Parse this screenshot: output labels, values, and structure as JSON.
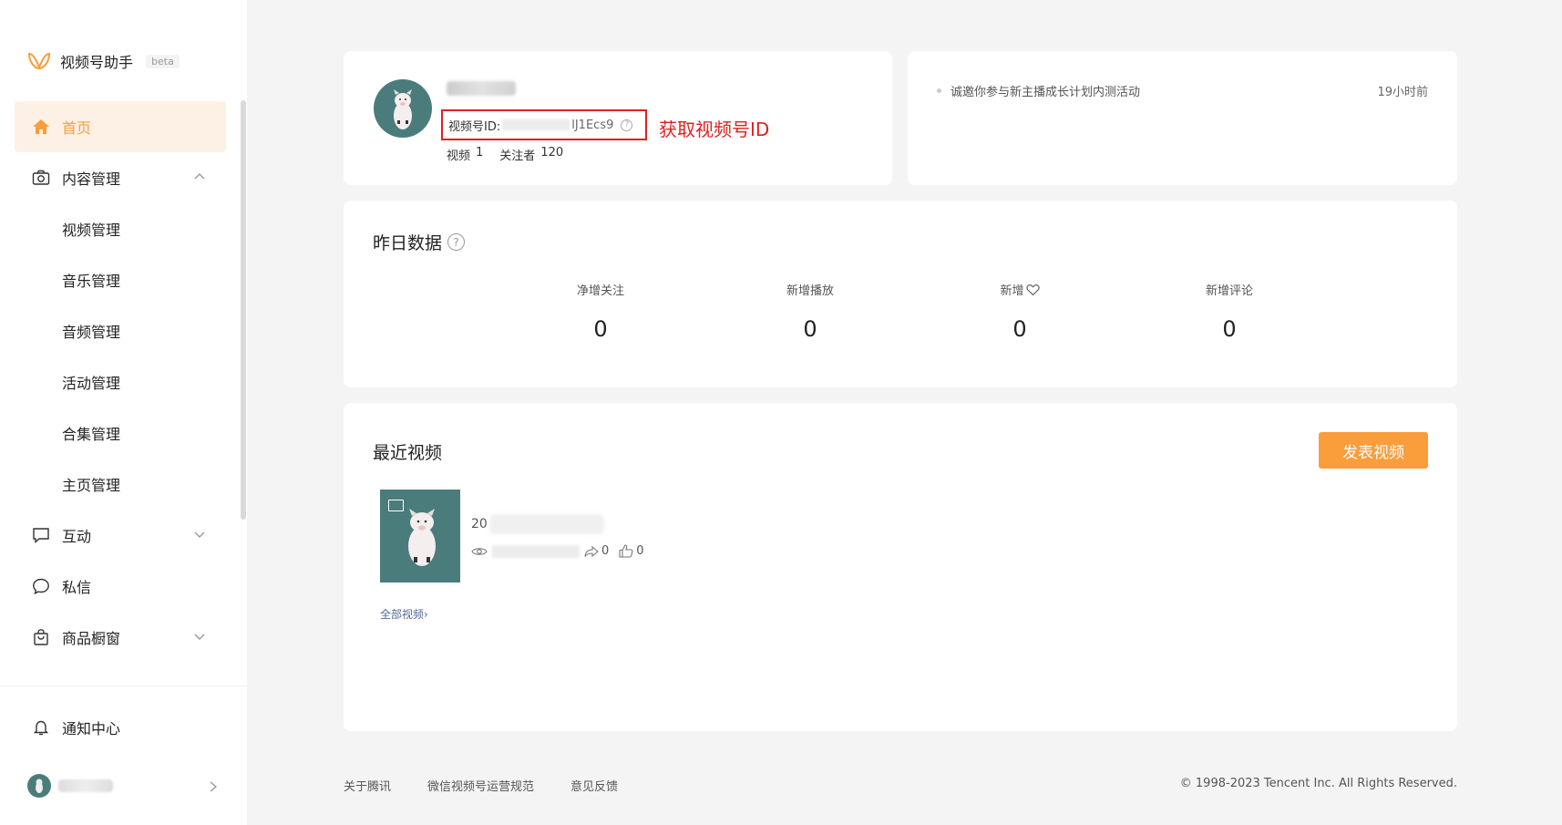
{
  "sidebar": {
    "brand": "视频号助手",
    "beta": "beta",
    "accent_color": "#fa9d3b",
    "items": [
      {
        "label": "首页",
        "icon": "home-icon",
        "active": true
      },
      {
        "label": "内容管理",
        "icon": "camera-icon",
        "expanded": true
      },
      {
        "label": "互动",
        "icon": "message-square-icon",
        "expanded": false
      },
      {
        "label": "私信",
        "icon": "chat-bubble-icon"
      },
      {
        "label": "商品橱窗",
        "icon": "shopping-bag-icon",
        "expanded": false
      }
    ],
    "content_sub": [
      "视频管理",
      "音乐管理",
      "音频管理",
      "活动管理",
      "合集管理",
      "主页管理"
    ],
    "notify": {
      "label": "通知中心",
      "icon": "bell-icon"
    }
  },
  "profile": {
    "id_label": "视频号ID:",
    "id_tail": "lJ1Ecs9",
    "annotation": "获取视频号ID",
    "videos_label": "视频",
    "videos_count": "1",
    "followers_label": "关注者",
    "followers_count": "120"
  },
  "notice": {
    "text": "诚邀你参与新主播成长计划内测活动",
    "time": "19小时前"
  },
  "yesterday": {
    "title": "昨日数据",
    "help": "?",
    "metrics": [
      {
        "label": "净增关注",
        "value": "0"
      },
      {
        "label": "新增播放",
        "value": "0"
      },
      {
        "label": "新增",
        "value": "0",
        "icon": "heart-icon"
      },
      {
        "label": "新增评论",
        "value": "0"
      }
    ]
  },
  "recent": {
    "title": "最近视频",
    "publish_button": "发表视频",
    "video": {
      "title_prefix": "20",
      "shares": "0",
      "likes": "0"
    },
    "all_link": "全部视频"
  },
  "footer": {
    "links": [
      "关于腾讯",
      "微信视频号运营规范",
      "意见反馈"
    ],
    "copyright": "© 1998-2023 Tencent Inc. All Rights Reserved."
  }
}
